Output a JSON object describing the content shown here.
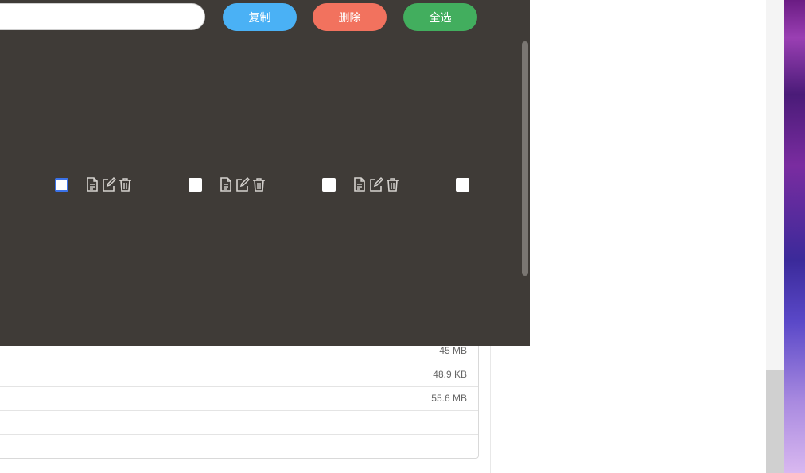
{
  "toolbar": {
    "copy_label": "复制",
    "delete_label": "删除",
    "select_all_label": "全选",
    "search_value": ""
  },
  "file_rows": [
    {
      "size": "45 MB"
    },
    {
      "size": "48.9 KB"
    },
    {
      "size": "55.6 MB"
    },
    {
      "size": ""
    },
    {
      "size": ""
    }
  ],
  "grid_items": [
    {
      "checked": false,
      "focused": true,
      "icons": [
        "file-icon",
        "edit-icon",
        "trash-icon"
      ]
    },
    {
      "checked": false,
      "focused": false,
      "icons": [
        "file-icon",
        "edit-icon",
        "trash-icon"
      ]
    },
    {
      "checked": false,
      "focused": false,
      "icons": [
        "file-icon",
        "edit-icon",
        "trash-icon"
      ]
    },
    {
      "checked": false,
      "focused": false,
      "icons": []
    }
  ],
  "colors": {
    "modal_bg": "#3f3b37",
    "copy": "#4ab1f5",
    "delete": "#f2725e",
    "select_all": "#42ae5e",
    "focus": "#3b72e8"
  }
}
